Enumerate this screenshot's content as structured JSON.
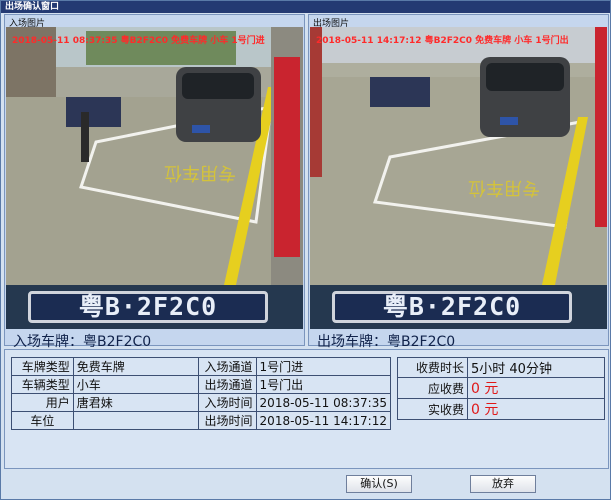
{
  "window": {
    "title": "出场确认窗口"
  },
  "entry": {
    "caption": "入场图片",
    "overlay": "2018-05-11 08:37:35 粤B2F2C0 免费车牌 小车 1号门进",
    "plate": "粤B·2F2C0",
    "plate_label": "入场车牌：粤B2F2C0"
  },
  "exit": {
    "caption": "出场图片",
    "overlay": "2018-05-11 14:17:12 粤B2F2C0 免费车牌 小车 1号门出",
    "plate": "粤B·2F2C0",
    "plate_label": "出场车牌：粤B2F2C0"
  },
  "details": {
    "plate_type_label": "车牌类型",
    "plate_type": "免费车牌",
    "vehicle_type_label": "车辆类型",
    "vehicle_type": "小车",
    "user_label": "用户",
    "user": "唐君妹",
    "spot_label": "车位",
    "spot": "",
    "entry_lane_label": "入场通道",
    "entry_lane": "1号门进",
    "exit_lane_label": "出场通道",
    "exit_lane": "1号门出",
    "entry_time_label": "入场时间",
    "entry_time": "2018-05-11 08:37:35",
    "exit_time_label": "出场时间",
    "exit_time": "2018-05-11 14:17:12"
  },
  "fees": {
    "duration_label": "收费时长",
    "duration": "5小时 40分钟",
    "due_label": "应收费",
    "due": "0 元",
    "paid_label": "实收费",
    "paid": "0 元"
  },
  "buttons": {
    "confirm": "确认(S)",
    "cancel": "放弃"
  },
  "colors": {
    "accent": "#243a73",
    "money": "#e01818"
  }
}
